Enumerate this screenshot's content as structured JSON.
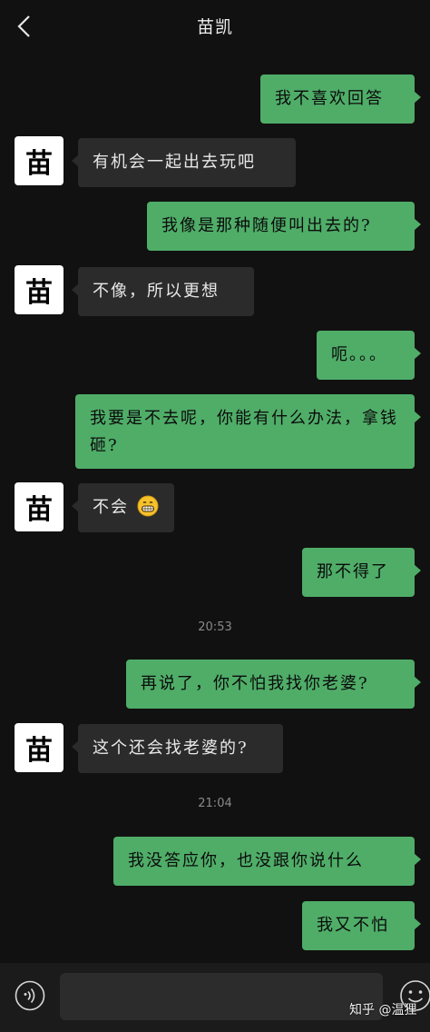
{
  "header": {
    "title": "苗凯"
  },
  "contact": {
    "avatar_text": "苗"
  },
  "messages": [
    {
      "side": "me",
      "text": "我不喜欢回答"
    },
    {
      "side": "them",
      "text": "有机会一起出去玩吧"
    },
    {
      "side": "me",
      "text": "我像是那种随便叫出去的?"
    },
    {
      "side": "them",
      "text": "不像，所以更想"
    },
    {
      "side": "me",
      "text": "呃。。。"
    },
    {
      "side": "me",
      "text": "我要是不去呢，你能有什么办法，拿钱砸?"
    },
    {
      "side": "them",
      "text": "不会",
      "emoji": "grinning-face-emoji"
    },
    {
      "side": "me",
      "text": "那不得了"
    },
    {
      "side": "time",
      "text": "20:53"
    },
    {
      "side": "me",
      "text": "再说了，你不怕我找你老婆?"
    },
    {
      "side": "them",
      "text": "这个还会找老婆的?"
    },
    {
      "side": "time",
      "text": "21:04"
    },
    {
      "side": "me",
      "text": "我没答应你，也没跟你说什么"
    },
    {
      "side": "me",
      "text": "我又不怕"
    }
  ],
  "watermark": "知乎 @温狸",
  "colors": {
    "background": "#111111",
    "my_bubble": "#4fad68",
    "their_bubble": "#2b2b2b",
    "avatar_bg": "#ffffff"
  },
  "icons": {
    "back": "chevron-left-icon",
    "voice": "voice-icon",
    "emoji": "emoji-icon"
  }
}
